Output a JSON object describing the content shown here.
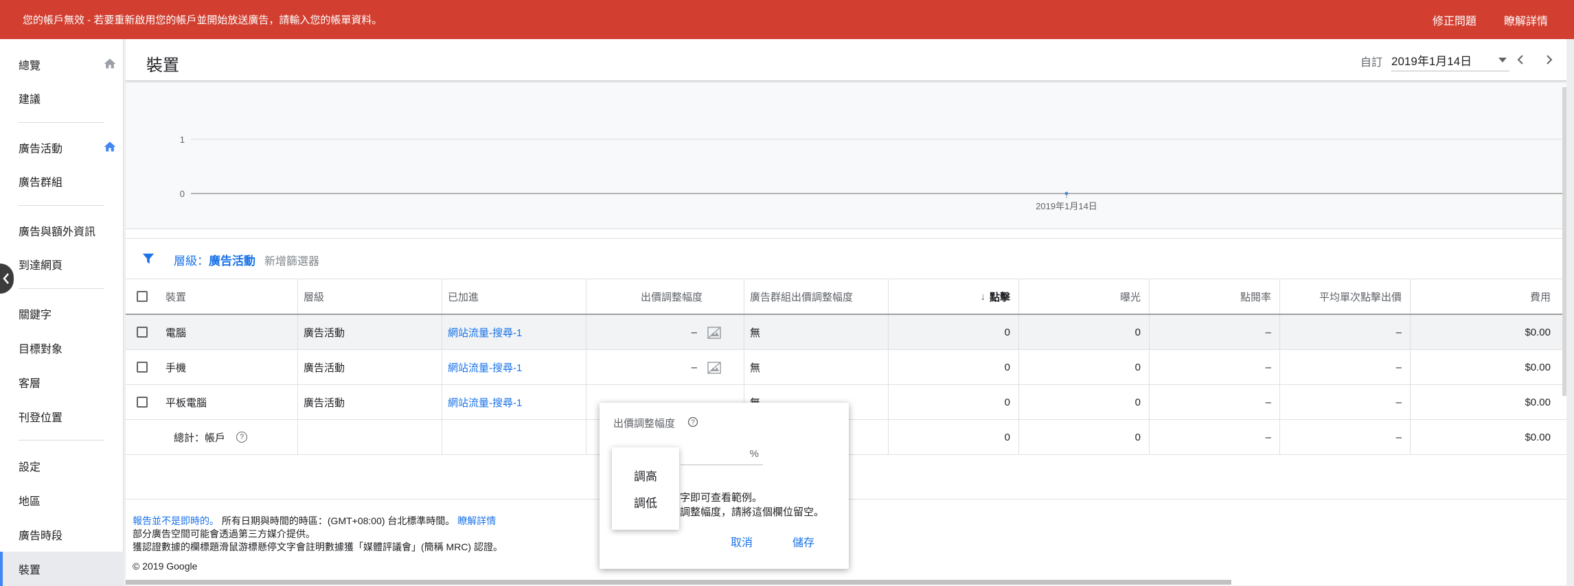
{
  "banner": {
    "message": "您的帳戶無效 - 若要重新啟用您的帳戶並開始放送廣告，請輸入您的帳單資料。",
    "fix_label": "修正問題",
    "learn_label": "瞭解詳情"
  },
  "sidebar": {
    "items": [
      {
        "label": "總覽"
      },
      {
        "label": "建議"
      },
      {
        "label": "廣告活動"
      },
      {
        "label": "廣告群組"
      },
      {
        "label": "廣告與額外資訊"
      },
      {
        "label": "到達網頁"
      },
      {
        "label": "關鍵字"
      },
      {
        "label": "目標對象"
      },
      {
        "label": "客層"
      },
      {
        "label": "刊登位置"
      },
      {
        "label": "設定"
      },
      {
        "label": "地區"
      },
      {
        "label": "廣告時段"
      },
      {
        "label": "裝置"
      }
    ],
    "active_color": "#4285f4"
  },
  "header": {
    "title": "裝置",
    "date_label": "自訂",
    "date_value": "2019年1月14日"
  },
  "chart": {
    "y_ticks": [
      "1",
      "0"
    ],
    "x_label": "2019年1月14日"
  },
  "filter": {
    "level_prefix": "層級：",
    "level_value": "廣告活動",
    "add_filter": "新增篩選器"
  },
  "table": {
    "columns": [
      "裝置",
      "層級",
      "已加進",
      "出價調整幅度",
      "廣告群組出價調整幅度",
      "點擊",
      "曝光",
      "點閱率",
      "平均單次點擊出價",
      "費用"
    ],
    "rows": [
      {
        "device": "電腦",
        "level": "廣告活動",
        "added_to": "網站流量-搜尋-1",
        "bid_adj": "–",
        "adgroup_bid_adj": "無",
        "clicks": "0",
        "impressions": "0",
        "ctr": "–",
        "avg_cpc": "–",
        "cost": "$0.00"
      },
      {
        "device": "手機",
        "level": "廣告活動",
        "added_to": "網站流量-搜尋-1",
        "bid_adj": "–",
        "adgroup_bid_adj": "無",
        "clicks": "0",
        "impressions": "0",
        "ctr": "–",
        "avg_cpc": "–",
        "cost": "$0.00"
      },
      {
        "device": "平板電腦",
        "level": "廣告活動",
        "added_to": "網站流量-搜尋-1",
        "bid_adj": "",
        "adgroup_bid_adj": "無",
        "clicks": "0",
        "impressions": "0",
        "ctr": "–",
        "avg_cpc": "–",
        "cost": "$0.00"
      }
    ],
    "total": {
      "label": "總計：帳戶",
      "clicks": "0",
      "impressions": "0",
      "ctr": "–",
      "avg_cpc": "–",
      "cost": "$0.00"
    }
  },
  "footer": {
    "report_link": "報告並不是即時的。",
    "timezone_text": "所有日期與時間的時區：(GMT+08:00) 台北標準時間。",
    "learn_link": "瞭解詳情",
    "line2": "部分廣告空間可能會透過第三方媒介提供。",
    "line3": "獲認證數據的欄標題滑鼠游標懸停文字會註明數據獲「媒體評議會」(簡稱 MRC) 認證。",
    "copyright": "© 2019 Google"
  },
  "popup": {
    "title": "出價調整幅度",
    "pct_sign": "%",
    "hint1": "字即可查看範例。",
    "hint2": "調整幅度，請將這個欄位留空。",
    "cancel": "取消",
    "save": "儲存",
    "options": [
      "調高",
      "調低"
    ]
  }
}
